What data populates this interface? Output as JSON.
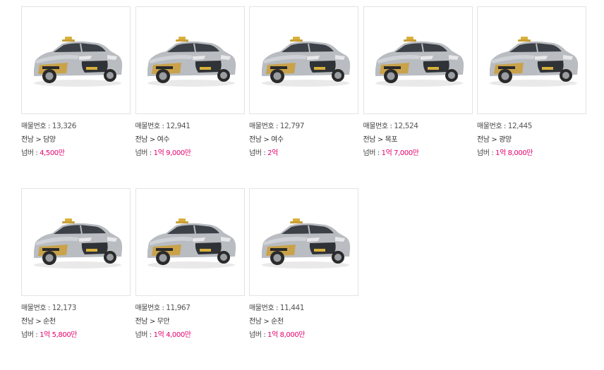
{
  "listing": {
    "items": [
      {
        "number_label": "매물번호",
        "number": "13,326",
        "region": "전남 > 담양",
        "price_label": "넘버",
        "price": "4,500만"
      },
      {
        "number_label": "매물번호",
        "number": "12,941",
        "region": "전남 > 여수",
        "price_label": "넘버",
        "price": "1억 9,000만"
      },
      {
        "number_label": "매물번호",
        "number": "12,797",
        "region": "전남 > 여수",
        "price_label": "넘버",
        "price": "2억"
      },
      {
        "number_label": "매물번호",
        "number": "12,524",
        "region": "전남 > 목포",
        "price_label": "넘버",
        "price": "1억 7,000만"
      },
      {
        "number_label": "매물번호",
        "number": "12,445",
        "region": "전남 > 광양",
        "price_label": "넘버",
        "price": "1억 8,000만"
      },
      {
        "number_label": "매물번호",
        "number": "12,173",
        "region": "전남 > 순천",
        "price_label": "넘버",
        "price": "1억 5,800만"
      },
      {
        "number_label": "매물번호",
        "number": "11,967",
        "region": "전남 > 무안",
        "price_label": "넘버",
        "price": "1억 4,000만"
      },
      {
        "number_label": "매물번호",
        "number": "11,441",
        "region": "전남 > 순천",
        "price_label": "넘버",
        "price": "1억 8,000만"
      }
    ]
  },
  "colors": {
    "price": "#e6006e",
    "card_border": "#e3e3e3",
    "car_body": "#b9bcc0",
    "taxi_stripe": "#c9a24a"
  },
  "icons": {
    "thumbnail": "taxi-car-image"
  }
}
